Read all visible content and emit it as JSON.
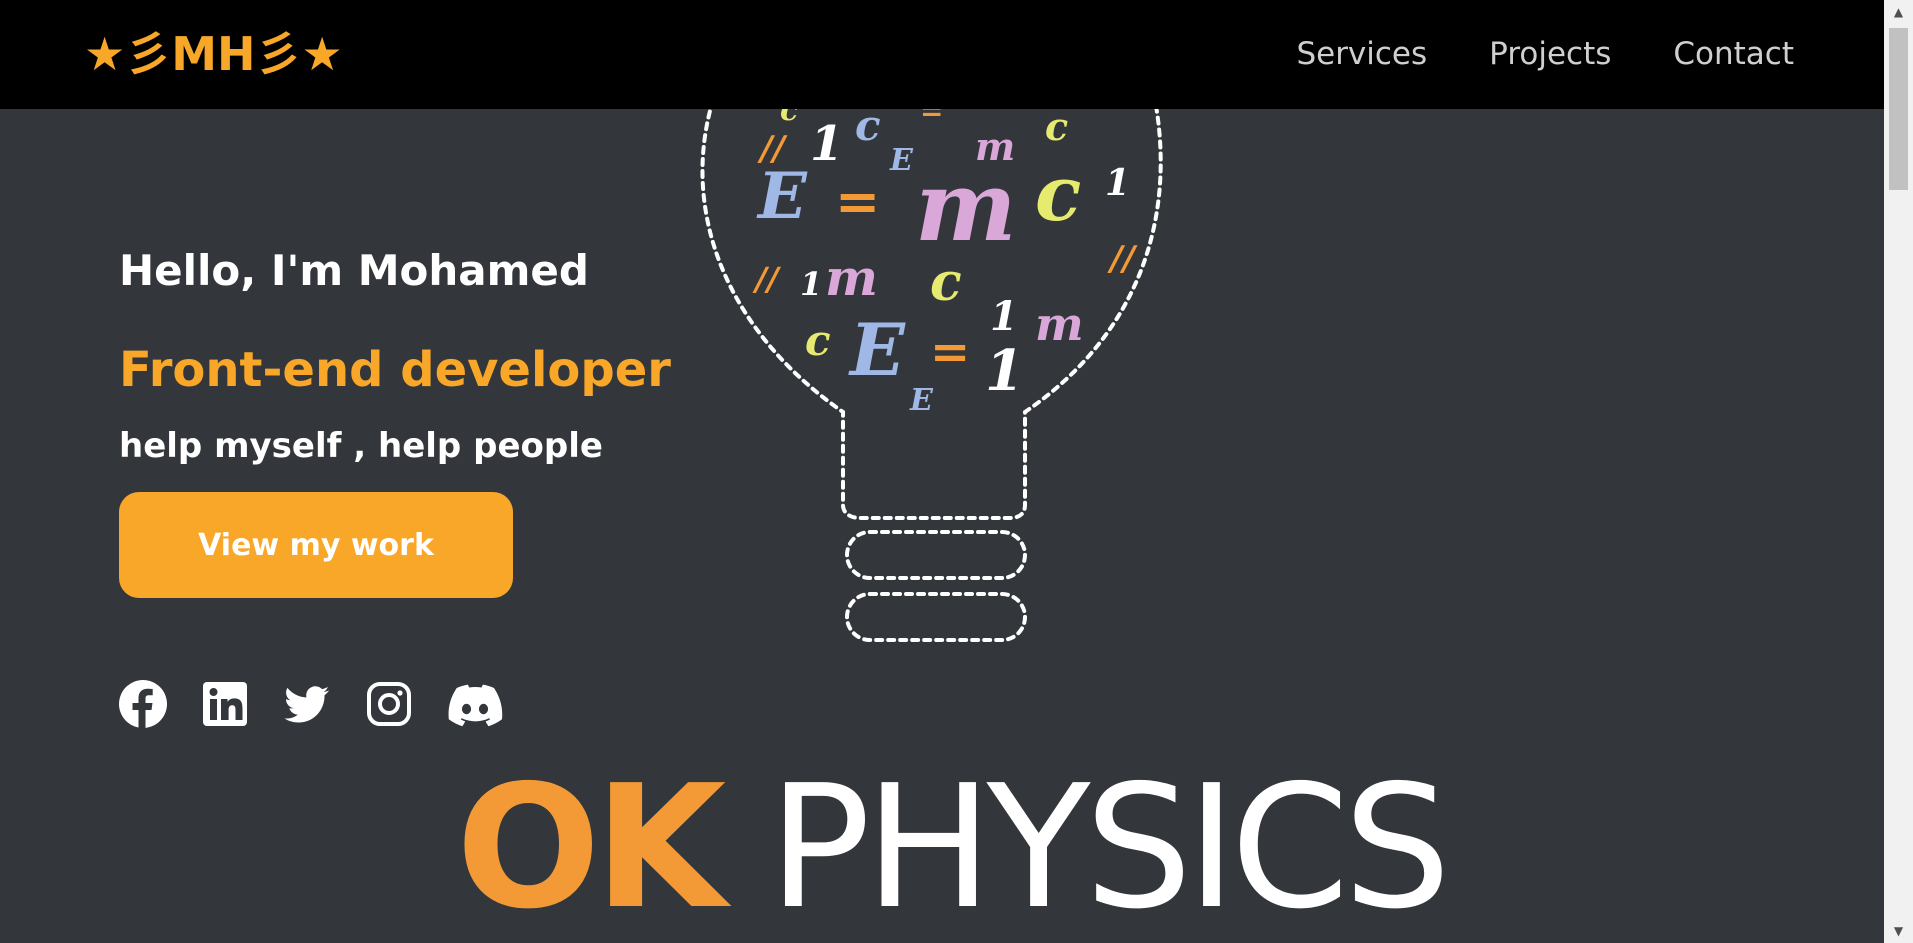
{
  "navbar": {
    "logo": "★彡MH彡★",
    "links": [
      "Services",
      "Projects",
      "Contact"
    ]
  },
  "hero": {
    "greeting": "Hello, I'm Mohamed",
    "role": "Front-end developer",
    "tagline": "help myself , help people",
    "cta_label": "View my work"
  },
  "social": {
    "icons": [
      "facebook-icon",
      "linkedin-icon",
      "twitter-icon",
      "instagram-icon",
      "discord-icon"
    ]
  },
  "illustration": {
    "brand_part1": "OK",
    "brand_part2": "PHYSICS"
  },
  "colors": {
    "accent": "#f8a729",
    "background": "#33363b",
    "navbar": "#000000",
    "text": "#ffffff"
  }
}
